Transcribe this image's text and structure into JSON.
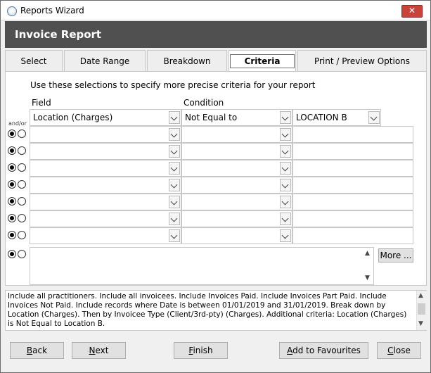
{
  "window": {
    "title": "Reports Wizard",
    "close_glyph": "✕"
  },
  "banner": {
    "title": "Invoice Report"
  },
  "tabs": [
    {
      "label": "Select"
    },
    {
      "label": "Date Range"
    },
    {
      "label": "Breakdown"
    },
    {
      "label": "Criteria",
      "active": true
    },
    {
      "label": "Print / Preview Options"
    }
  ],
  "criteria": {
    "instructions": "Use these selections to specify more precise criteria for your report",
    "field_header": "Field",
    "condition_header": "Condition",
    "andor_label": "and/or",
    "first_row": {
      "field": "Location (Charges)",
      "condition": "Not Equal to",
      "value": "LOCATION B"
    },
    "more_label": "More ...",
    "scroll_up": "▲",
    "scroll_down": "▼"
  },
  "summary": {
    "text": "Include all practitioners. Include all invoicees. Include Invoices Paid. Include Invoices Part Paid. Include Invoices Not Paid. Include records where Date is between 01/01/2019 and 31/01/2019. Break down by Location (Charges). Then by Invoicee Type (Client/3rd-pty) (Charges). Additional criteria: Location (Charges) is Not Equal to Location B.",
    "scroll_up": "▲",
    "scroll_down": "▼"
  },
  "footer": {
    "back": {
      "accel": "B",
      "rest": "ack"
    },
    "next": {
      "accel": "N",
      "rest": "ext"
    },
    "finish": {
      "accel": "F",
      "rest": "inish"
    },
    "favourites": {
      "accel": "A",
      "rest": "dd to Favourites"
    },
    "close": {
      "accel": "C",
      "rest": "lose"
    }
  }
}
